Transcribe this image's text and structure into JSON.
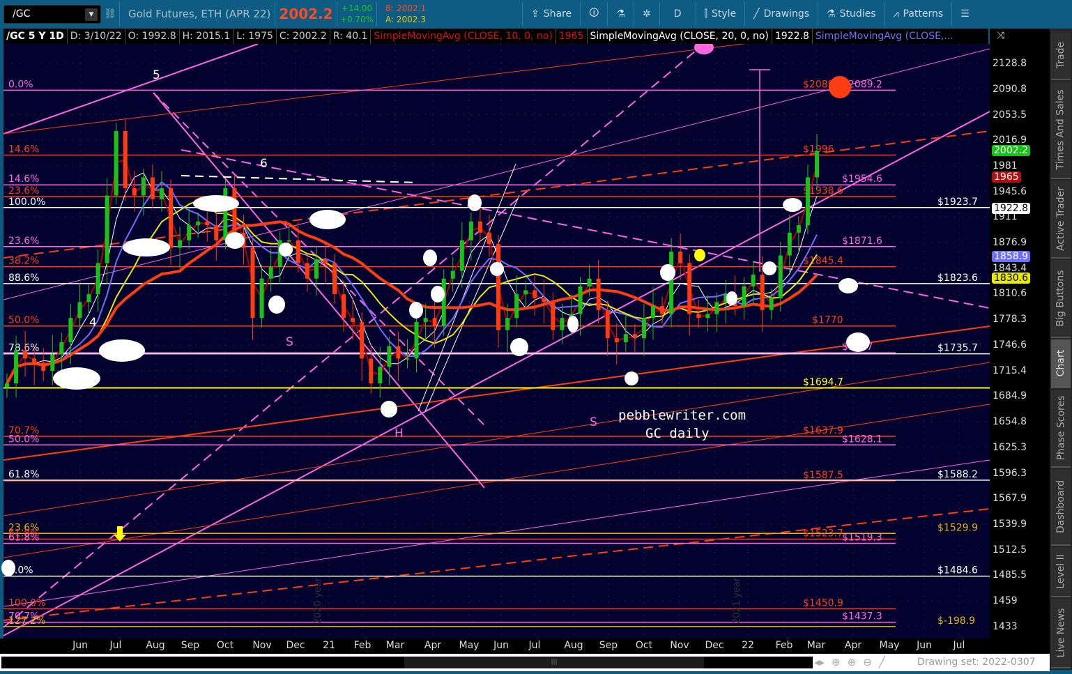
{
  "toolbar": {
    "symbol": "/GC",
    "description": "Gold Futures, ETH (APR 22)",
    "last": "2002.2",
    "change": "+14.00",
    "change_pct": "+0.70%",
    "bid": "B: 2002.1",
    "ask": "A: 2002.3",
    "buttons": {
      "share": "Share",
      "period": "D",
      "style": "Style",
      "drawings": "Drawings",
      "studies": "Studies",
      "patterns": "Patterns"
    }
  },
  "legend": {
    "title": "/GC 5 Y 1D",
    "date": "D: 3/10/22",
    "open": "O: 1992.8",
    "high": "H: 2015.1",
    "low": "L: 1975",
    "close": "C: 2002.2",
    "range": "R: 40.1",
    "sma1": "SimpleMovingAvg (CLOSE, 10, 0, no)",
    "sma1_val": "1965",
    "sma2": "SimpleMovingAvg (CLOSE, 20, 0, no)",
    "sma2_val": "1922.8",
    "sma3": "SimpleMovingAvg (CLOSE,..."
  },
  "colors": {
    "up": "#19c219",
    "down": "#ff3b10",
    "pink": "#ff66e0",
    "orange": "#ff3d12",
    "white": "#ffffff",
    "gold": "#e6b800",
    "yellow": "#ffff00",
    "blue": "#6f6fff",
    "bg": "#03022f"
  },
  "chart_data": {
    "type": "candlestick",
    "title": "/GC 5 Y 1D",
    "scale": "log",
    "ylim": [
      1433,
      2128.8
    ],
    "y_ticks": [
      2128.8,
      2090.8,
      2053.5,
      2016.9,
      1981,
      1945.6,
      1911,
      1876.9,
      1843.4,
      1810.6,
      1778.3,
      1746.6,
      1715.4,
      1684.9,
      1654.8,
      1625.3,
      1596.3,
      1567.9,
      1539.9,
      1512.5,
      1485.5,
      1459,
      1433
    ],
    "x_labels": [
      "Jun",
      "Jul",
      "Aug",
      "Sep",
      "Oct",
      "Nov",
      "Dec",
      "21",
      "Feb",
      "Mar",
      "Apr",
      "May",
      "Jun",
      "Jul",
      "Aug",
      "Sep",
      "Oct",
      "Nov",
      "Dec",
      "22",
      "Feb",
      "Mar",
      "Apr",
      "May",
      "Jun",
      "Jul"
    ],
    "weekly_close": [
      1700,
      1740,
      1730,
      1725,
      1715,
      1735,
      1750,
      1780,
      1800,
      1810,
      1850,
      1940,
      2030,
      1950,
      1940,
      1965,
      1935,
      1950,
      1870,
      1880,
      1900,
      1905,
      1900,
      1880,
      1950,
      1890,
      1870,
      1780,
      1830,
      1845,
      1880,
      1880,
      1850,
      1830,
      1855,
      1850,
      1810,
      1780,
      1775,
      1730,
      1700,
      1720,
      1745,
      1730,
      1730,
      1775,
      1780,
      1770,
      1830,
      1840,
      1880,
      1905,
      1890,
      1875,
      1765,
      1780,
      1810,
      1815,
      1805,
      1800,
      1765,
      1780,
      1785,
      1820,
      1830,
      1790,
      1755,
      1750,
      1760,
      1755,
      1780,
      1795,
      1785,
      1865,
      1850,
      1785,
      1780,
      1785,
      1800,
      1810,
      1795,
      1820,
      1835,
      1790,
      1805,
      1860,
      1890,
      1900,
      1965,
      2002
    ],
    "price_badges": [
      {
        "value": "2002.2",
        "bg": "#19c219",
        "fg": "#fff"
      },
      {
        "value": "1965",
        "bg": "#b01010",
        "fg": "#fff"
      },
      {
        "value": "1922.8",
        "bg": "#ffffff",
        "fg": "#000"
      },
      {
        "value": "1858.9",
        "bg": "#6f6fff",
        "fg": "#fff"
      },
      {
        "value": "1830.6",
        "bg": "#e8e800",
        "fg": "#000"
      }
    ],
    "levels": [
      {
        "price": 2089.2,
        "left": "0.0%",
        "right": "$2089.2",
        "right2": "$2089",
        "color": "#ff66e0"
      },
      {
        "price": 1996,
        "left": "14.6%",
        "right": "$1996",
        "color": "#ff3d12"
      },
      {
        "price": 1954.6,
        "left": "14.6%",
        "right": "$1954.6",
        "color": "#ff66e0"
      },
      {
        "price": 1938.6,
        "left": "23.6%",
        "right": "$1938.6",
        "color": "#ff3d12"
      },
      {
        "price": 1923.7,
        "left": "100.0%",
        "right": "$1923.7",
        "color": "#ffffff"
      },
      {
        "price": 1871.6,
        "left": "23.6%",
        "right": "$1871.6",
        "color": "#ff66e0"
      },
      {
        "price": 1845.4,
        "left": "38.2%",
        "right": "$1845.4",
        "color": "#ff3d12"
      },
      {
        "price": 1823.6,
        "left": "88.6%",
        "right": "$1823.6",
        "color": "#ffffff"
      },
      {
        "price": 1770,
        "left": "50.0%",
        "right": "$1770",
        "color": "#ff3d12"
      },
      {
        "price": 1737,
        "left": "",
        "right": "$1737",
        "color": "#ff66e0"
      },
      {
        "price": 1735.7,
        "left": "78.6%",
        "right": "$1735.7",
        "color": "#ffffff"
      },
      {
        "price": 1694.7,
        "left": "",
        "right": "$1694.7",
        "color": "#ffff00"
      },
      {
        "price": 1637.9,
        "left": "70.7%",
        "right": "$1637.9",
        "color": "#ff3d12"
      },
      {
        "price": 1628.1,
        "left": "50.0%",
        "right": "$1628.1",
        "color": "#ff66e0"
      },
      {
        "price": 1587.5,
        "left": "",
        "right": "$1587.5",
        "color": "#ff3d12"
      },
      {
        "price": 1588.2,
        "left": "61.8%",
        "right": "$1588.2",
        "color": "#ffffff"
      },
      {
        "price": 1529.9,
        "left": "23.6%",
        "right": "$1529.9",
        "color": "#e6b800"
      },
      {
        "price": 1523.7,
        "left": "61.8%",
        "right": "$1523.7",
        "color": "#ff3d12"
      },
      {
        "price": 1519.3,
        "left": "61.8%",
        "right": "$1519.3",
        "color": "#ff66e0"
      },
      {
        "price": 1484.6,
        "left": "0.0%",
        "right": "$1484.6",
        "color": "#ffffff"
      },
      {
        "price": 1450.9,
        "left": "100.0%",
        "right": "$1450.9",
        "color": "#ff3d12"
      },
      {
        "price": 1437.3,
        "left": "70.7%",
        "right": "$1437.3",
        "color": "#ff66e0"
      },
      {
        "price": 1433,
        "left": "127.2%",
        "right": "$-198.9",
        "color": "#e6b800"
      }
    ],
    "annotations": {
      "wave5": "5",
      "wave6": "6",
      "wave4": "4",
      "s1": "S",
      "h": "H",
      "s2": "S",
      "watermark": "pebblewriter.com",
      "subtitle": "GC daily",
      "year2020": "2020 year",
      "year2021": "2021 year"
    }
  },
  "sidebar": [
    "Trade",
    "Times And Sales",
    "Active Trader",
    "Big Buttons",
    "Chart",
    "Phase Scores",
    "Dashboard",
    "Level II",
    "Live News"
  ],
  "footer": {
    "drawing_set": "Drawing set: 2022-0307"
  }
}
